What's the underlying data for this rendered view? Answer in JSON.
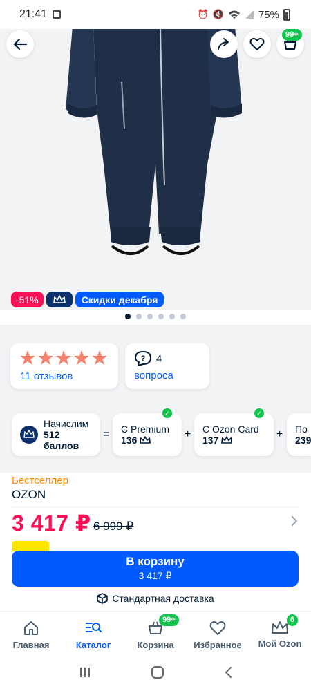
{
  "status_bar": {
    "time": "21:41",
    "battery": "75%"
  },
  "top_actions": {
    "cart_badge": "99+"
  },
  "promo_tags": {
    "discount": "-51%",
    "sale": "Скидки декабря"
  },
  "gallery": {
    "total_images": 6,
    "active_index": 0
  },
  "rating": {
    "stars": 5,
    "reviews_label": "11 отзывов"
  },
  "questions": {
    "count": "4",
    "label": "вопроса"
  },
  "bonuses": {
    "accrue_line1": "Начислим",
    "accrue_line2": "512 баллов",
    "premium_line1": "С Premium",
    "premium_line2": "136",
    "ozon_card_line1": "С Ozon Card",
    "ozon_card_line2": "137",
    "extra_line1": "По",
    "extra_line2": "239",
    "op_equal": "=",
    "op_plus1": "+",
    "op_plus2": "+"
  },
  "product": {
    "bestseller": "Бестселлер",
    "brand": "OZON",
    "price": "3 417 ₽",
    "old_price": "6 999 ₽"
  },
  "cart_button": {
    "label": "В корзину",
    "price": "3 417 ₽"
  },
  "delivery": {
    "label": "Стандартная доставка"
  },
  "bottom_nav": {
    "home": "Главная",
    "catalog": "Каталог",
    "cart": "Корзина",
    "cart_badge": "99+",
    "favorites": "Избранное",
    "my_ozon": "Мой Ozon",
    "my_ozon_badge": "6"
  },
  "colors": {
    "accent": "#005bff",
    "price": "#f91155",
    "success": "#10c44c",
    "star": "#f5826c",
    "bestseller": "#ff8a00"
  }
}
